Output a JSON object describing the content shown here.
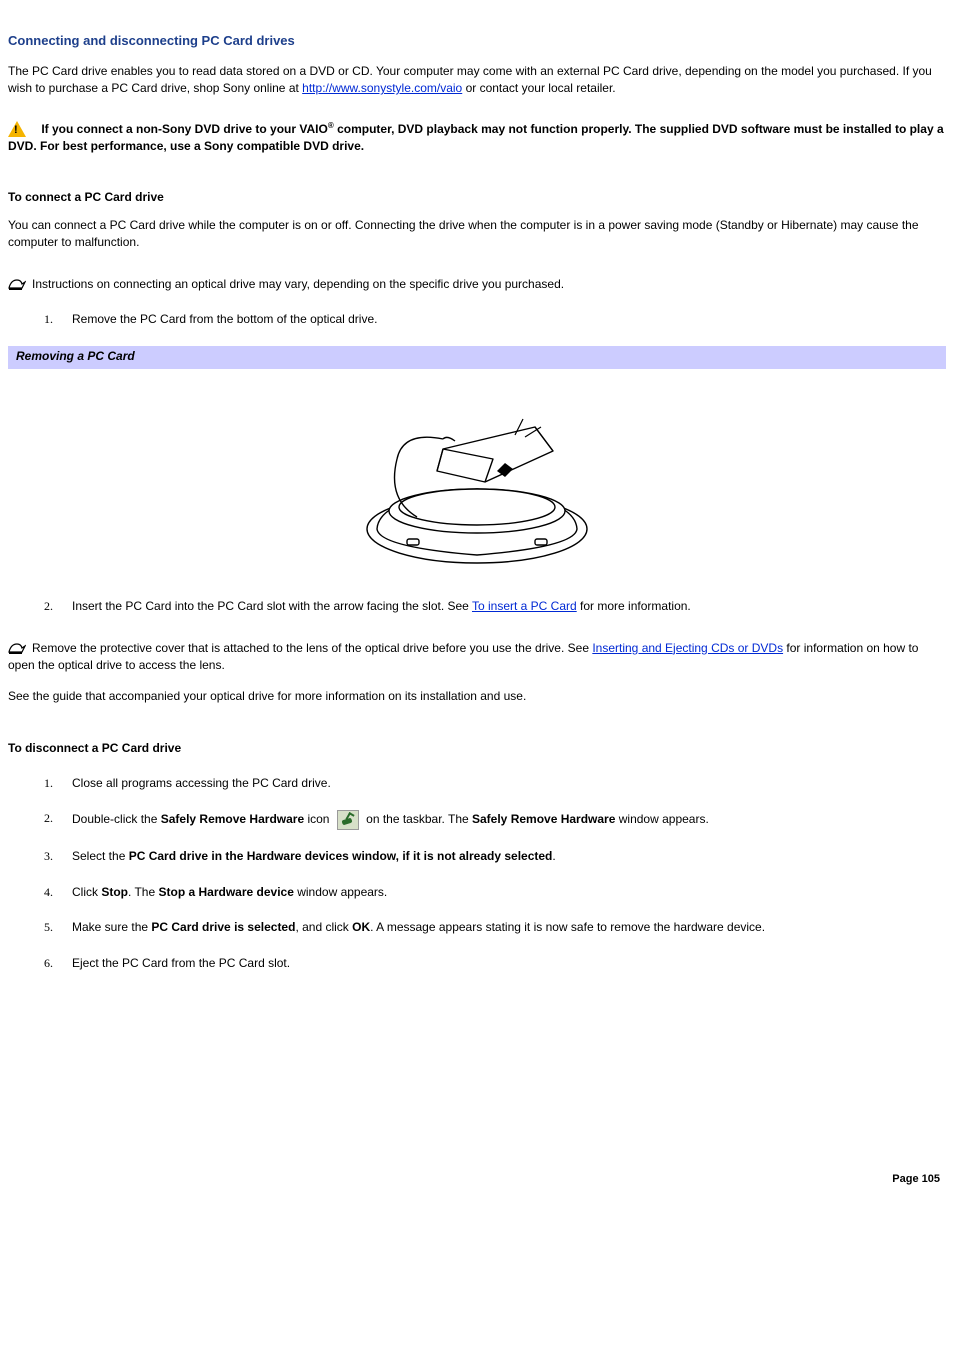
{
  "title": "Connecting and disconnecting PC Card drives",
  "intro": {
    "p1a": "The PC Card drive enables you to read data stored on a DVD or CD. Your computer may come with an external PC Card drive, depending on the model you purchased. If you wish to purchase a PC Card drive, shop Sony online at ",
    "link1": "http://www.sonystyle.com/vaio",
    "p1b": " or contact your local retailer."
  },
  "warning": {
    "t1": "If you connect a non-Sony DVD drive to your VAIO",
    "reg": "®",
    "t2": " computer, DVD playback may not function properly. The supplied DVD software must be installed to play a DVD. For best performance, use a Sony compatible DVD drive."
  },
  "connect": {
    "heading": "To connect a PC Card drive",
    "p1": "You can connect a PC Card drive while the computer is on or off. Connecting the drive when the computer is in a power saving mode (Standby or Hibernate) may cause the computer to malfunction.",
    "note1": "Instructions on connecting an optical drive may vary, depending on the specific drive you purchased.",
    "step1_num": "1.",
    "step1": "Remove the PC Card from the bottom of the optical drive.",
    "figure_caption": "Removing a PC Card",
    "step2_num": "2.",
    "step2a": "Insert the PC Card into the PC Card slot with the arrow facing the slot. See ",
    "step2_link": "To insert a PC Card",
    "step2b": " for more information.",
    "note2a": "Remove the protective cover that is attached to the lens of the optical drive before you use the drive. See ",
    "note2_link": "Inserting and Ejecting CDs or DVDs",
    "note2b": " for information on how to open the optical drive to access the lens.",
    "p_after": "See the guide that accompanied your optical drive for more information on its installation and use."
  },
  "disconnect": {
    "heading": "To disconnect a PC Card drive",
    "steps": [
      {
        "num": "1.",
        "parts": [
          {
            "t": "Close all programs accessing the PC Card drive."
          }
        ]
      },
      {
        "num": "2.",
        "parts": [
          {
            "t": "Double-click the "
          },
          {
            "b": "Safely Remove Hardware"
          },
          {
            "t": " icon "
          },
          {
            "icon": true
          },
          {
            "t": " on the taskbar. The "
          },
          {
            "b": "Safely Remove Hardware"
          },
          {
            "t": " window appears."
          }
        ]
      },
      {
        "num": "3.",
        "parts": [
          {
            "t": "Select the "
          },
          {
            "b": "PC Card drive in the Hardware devices window, if it is not already selected"
          },
          {
            "t": "."
          }
        ]
      },
      {
        "num": "4.",
        "parts": [
          {
            "t": "Click "
          },
          {
            "b": "Stop"
          },
          {
            "t": ". The "
          },
          {
            "b": "Stop a Hardware device"
          },
          {
            "t": " window appears."
          }
        ]
      },
      {
        "num": "5.",
        "parts": [
          {
            "t": "Make sure the "
          },
          {
            "b": "PC Card drive is selected"
          },
          {
            "t": ", and click "
          },
          {
            "b": "OK"
          },
          {
            "t": ". A message appears stating it is now safe to remove the hardware device."
          }
        ]
      },
      {
        "num": "6.",
        "parts": [
          {
            "t": "Eject the PC Card from the PC Card slot."
          }
        ]
      }
    ]
  },
  "page_number": "Page 105"
}
